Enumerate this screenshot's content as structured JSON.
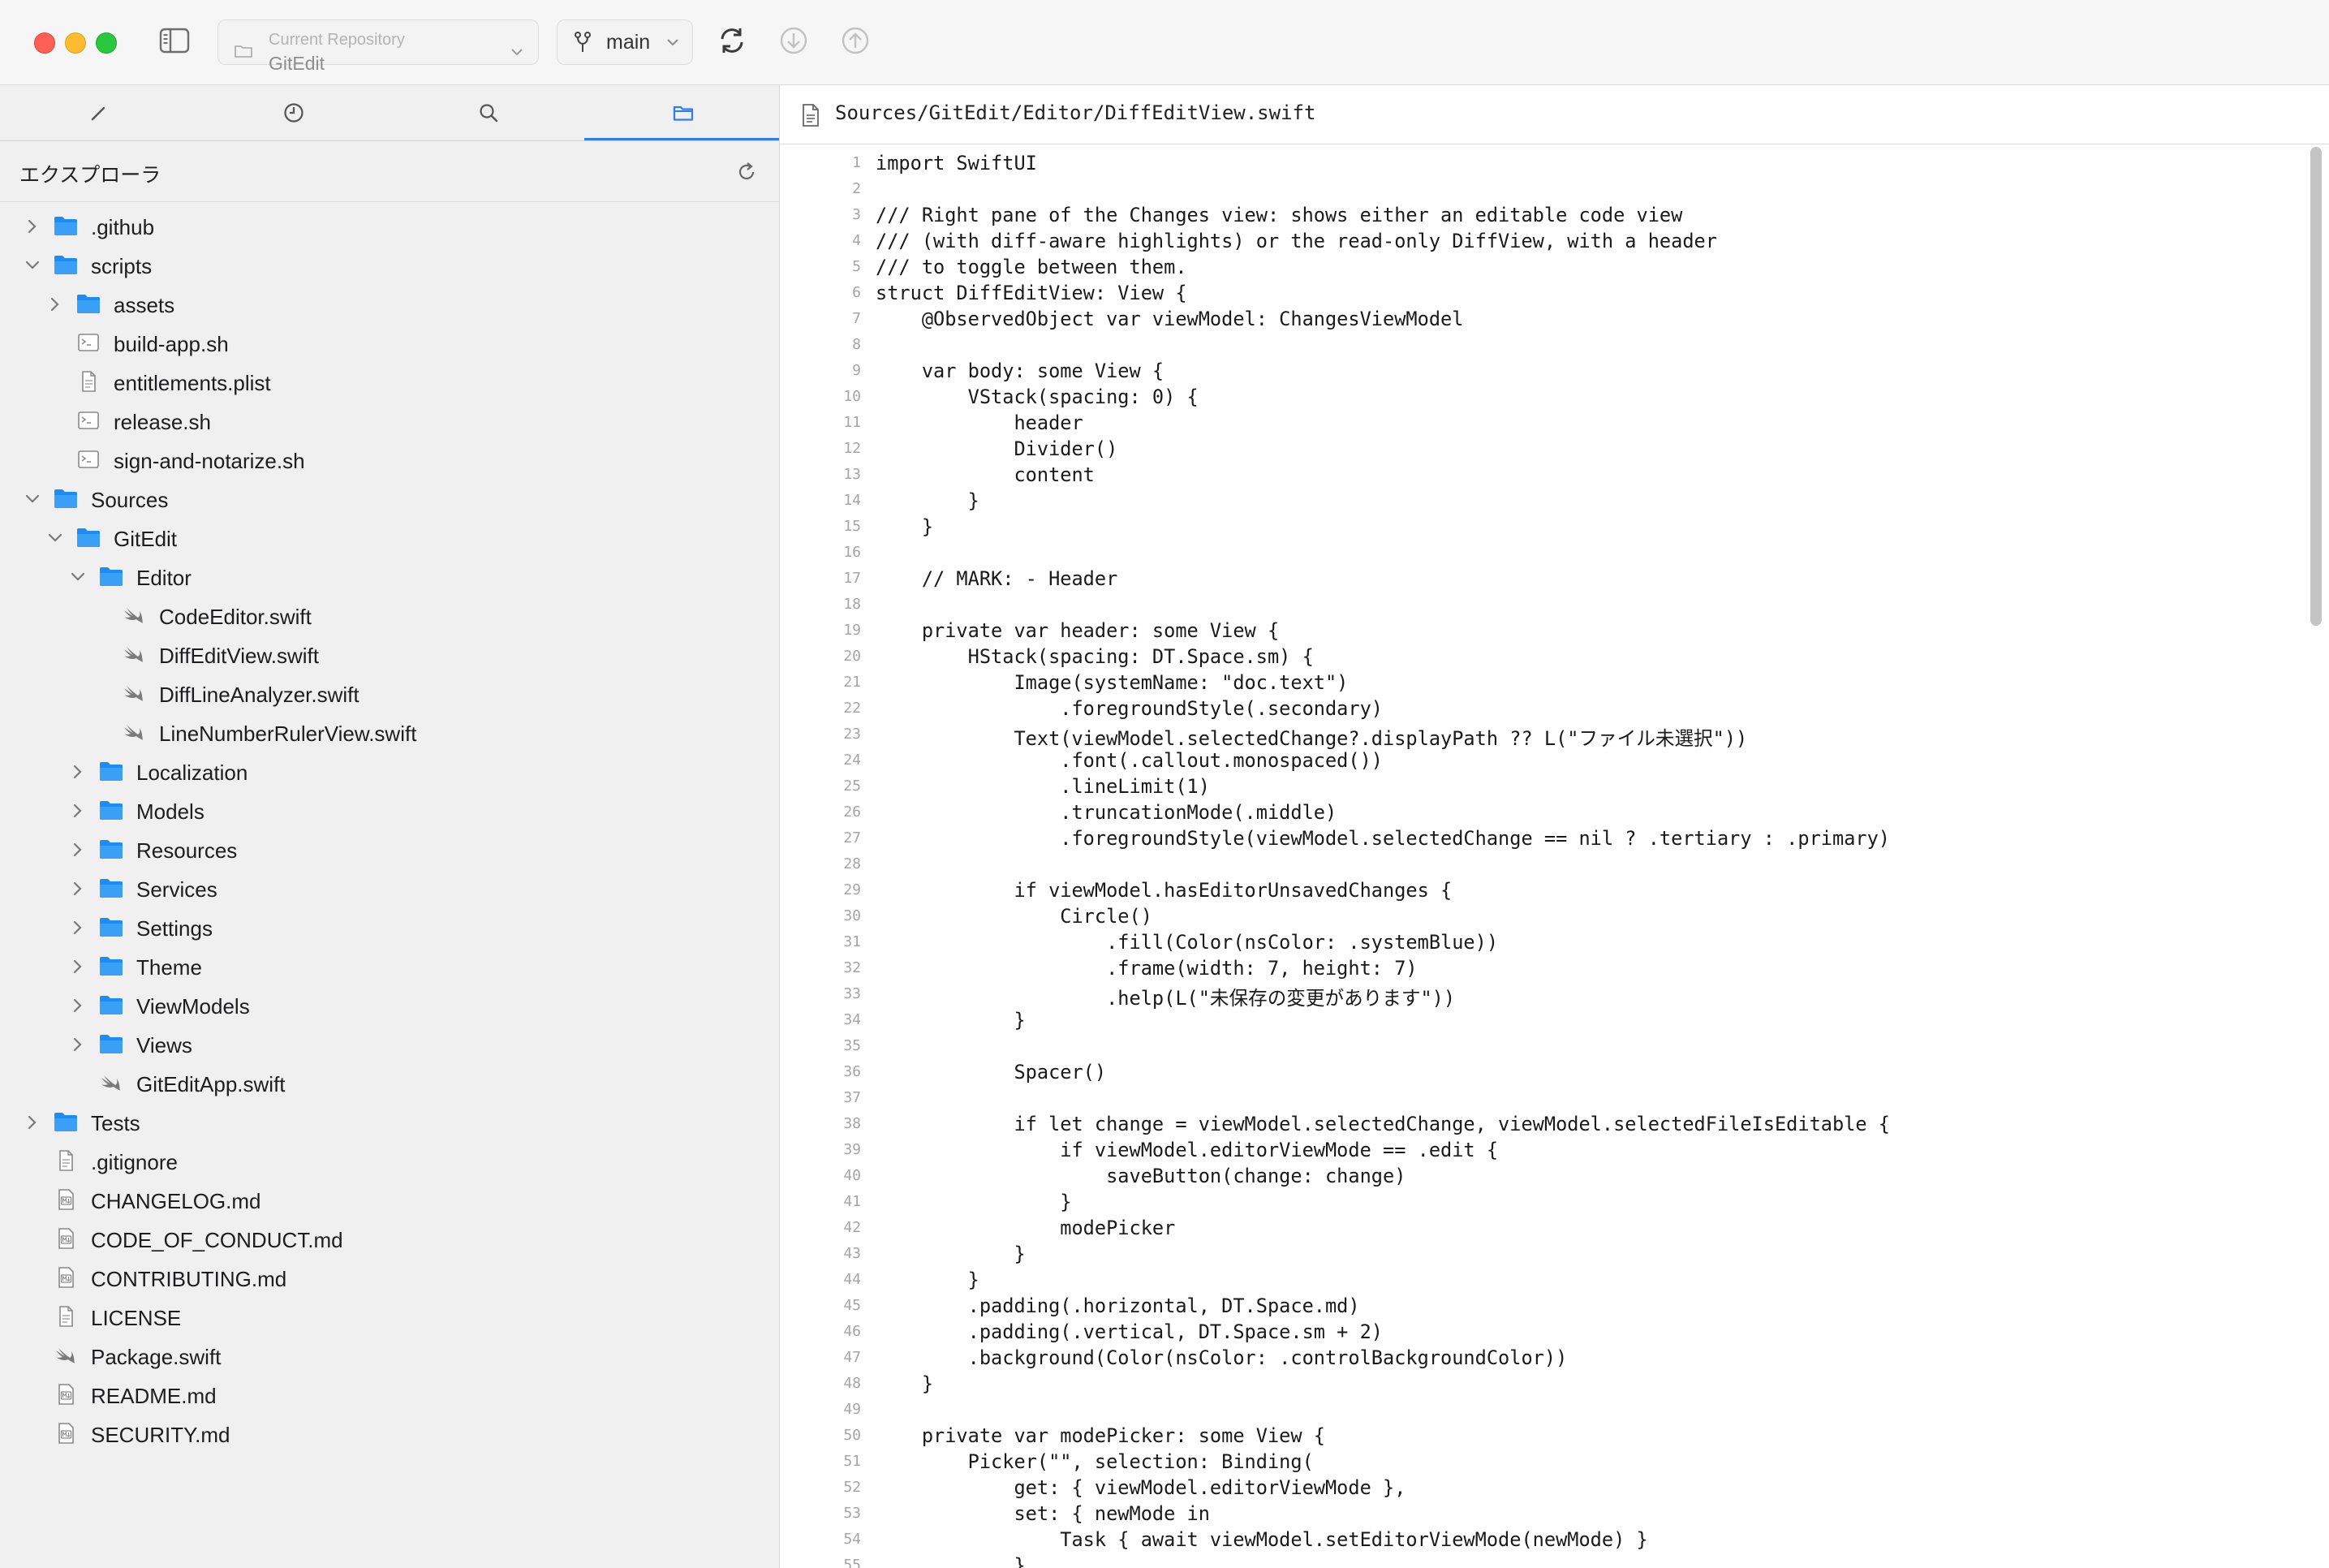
{
  "toolbar": {
    "repo_label": "Current Repository",
    "repo_name": "GitEdit",
    "branch": "main"
  },
  "sidebar": {
    "explorer_title": "エクスプローラ",
    "tree": [
      {
        "depth": 0,
        "type": "folder",
        "expanded": false,
        "label": ".github"
      },
      {
        "depth": 0,
        "type": "folder",
        "expanded": true,
        "label": "scripts"
      },
      {
        "depth": 1,
        "type": "folder",
        "expanded": false,
        "label": "assets"
      },
      {
        "depth": 1,
        "type": "script",
        "label": "build-app.sh"
      },
      {
        "depth": 1,
        "type": "doc",
        "label": "entitlements.plist"
      },
      {
        "depth": 1,
        "type": "script",
        "label": "release.sh"
      },
      {
        "depth": 1,
        "type": "script",
        "label": "sign-and-notarize.sh"
      },
      {
        "depth": 0,
        "type": "folder",
        "expanded": true,
        "label": "Sources"
      },
      {
        "depth": 1,
        "type": "folder",
        "expanded": true,
        "label": "GitEdit"
      },
      {
        "depth": 2,
        "type": "folder",
        "expanded": true,
        "label": "Editor"
      },
      {
        "depth": 3,
        "type": "swift",
        "label": "CodeEditor.swift"
      },
      {
        "depth": 3,
        "type": "swift",
        "label": "DiffEditView.swift"
      },
      {
        "depth": 3,
        "type": "swift",
        "label": "DiffLineAnalyzer.swift"
      },
      {
        "depth": 3,
        "type": "swift",
        "label": "LineNumberRulerView.swift"
      },
      {
        "depth": 2,
        "type": "folder",
        "expanded": false,
        "label": "Localization"
      },
      {
        "depth": 2,
        "type": "folder",
        "expanded": false,
        "label": "Models"
      },
      {
        "depth": 2,
        "type": "folder",
        "expanded": false,
        "label": "Resources"
      },
      {
        "depth": 2,
        "type": "folder",
        "expanded": false,
        "label": "Services"
      },
      {
        "depth": 2,
        "type": "folder",
        "expanded": false,
        "label": "Settings"
      },
      {
        "depth": 2,
        "type": "folder",
        "expanded": false,
        "label": "Theme"
      },
      {
        "depth": 2,
        "type": "folder",
        "expanded": false,
        "label": "ViewModels"
      },
      {
        "depth": 2,
        "type": "folder",
        "expanded": false,
        "label": "Views"
      },
      {
        "depth": 2,
        "type": "swift",
        "label": "GitEditApp.swift"
      },
      {
        "depth": 0,
        "type": "folder",
        "expanded": false,
        "label": "Tests"
      },
      {
        "depth": 0,
        "type": "doc",
        "label": ".gitignore"
      },
      {
        "depth": 0,
        "type": "md",
        "label": "CHANGELOG.md"
      },
      {
        "depth": 0,
        "type": "md",
        "label": "CODE_OF_CONDUCT.md"
      },
      {
        "depth": 0,
        "type": "md",
        "label": "CONTRIBUTING.md"
      },
      {
        "depth": 0,
        "type": "doc",
        "label": "LICENSE"
      },
      {
        "depth": 0,
        "type": "swift",
        "label": "Package.swift"
      },
      {
        "depth": 0,
        "type": "md",
        "label": "README.md"
      },
      {
        "depth": 0,
        "type": "md",
        "label": "SECURITY.md"
      }
    ]
  },
  "editor": {
    "path": "Sources/GitEdit/Editor/DiffEditView.swift",
    "lines": [
      "import SwiftUI",
      "",
      "/// Right pane of the Changes view: shows either an editable code view",
      "/// (with diff-aware highlights) or the read-only DiffView, with a header",
      "/// to toggle between them.",
      "struct DiffEditView: View {",
      "    @ObservedObject var viewModel: ChangesViewModel",
      "",
      "    var body: some View {",
      "        VStack(spacing: 0) {",
      "            header",
      "            Divider()",
      "            content",
      "        }",
      "    }",
      "",
      "    // MARK: - Header",
      "",
      "    private var header: some View {",
      "        HStack(spacing: DT.Space.sm) {",
      "            Image(systemName: \"doc.text\")",
      "                .foregroundStyle(.secondary)",
      "            Text(viewModel.selectedChange?.displayPath ?? L(\"ファイル未選択\"))",
      "                .font(.callout.monospaced())",
      "                .lineLimit(1)",
      "                .truncationMode(.middle)",
      "                .foregroundStyle(viewModel.selectedChange == nil ? .tertiary : .primary)",
      "",
      "            if viewModel.hasEditorUnsavedChanges {",
      "                Circle()",
      "                    .fill(Color(nsColor: .systemBlue))",
      "                    .frame(width: 7, height: 7)",
      "                    .help(L(\"未保存の変更があります\"))",
      "            }",
      "",
      "            Spacer()",
      "",
      "            if let change = viewModel.selectedChange, viewModel.selectedFileIsEditable {",
      "                if viewModel.editorViewMode == .edit {",
      "                    saveButton(change: change)",
      "                }",
      "                modePicker",
      "            }",
      "        }",
      "        .padding(.horizontal, DT.Space.md)",
      "        .padding(.vertical, DT.Space.sm + 2)",
      "        .background(Color(nsColor: .controlBackgroundColor))",
      "    }",
      "",
      "    private var modePicker: some View {",
      "        Picker(\"\", selection: Binding(",
      "            get: { viewModel.editorViewMode },",
      "            set: { newMode in",
      "                Task { await viewModel.setEditorViewMode(newMode) }",
      "            }"
    ]
  }
}
